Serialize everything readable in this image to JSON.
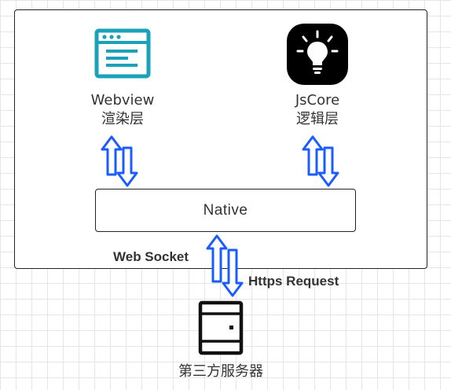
{
  "nodes": {
    "webview": {
      "title": "Webview",
      "subtitle": "渲染层",
      "icon": "browser-window-icon"
    },
    "jscore": {
      "title": "JsCore",
      "subtitle": "逻辑层",
      "icon": "lightbulb-icon"
    },
    "native": {
      "label": "Native"
    },
    "server": {
      "label": "第三方服务器",
      "icon": "server-icon"
    }
  },
  "edges": {
    "websocket": "Web Socket",
    "https": "Https Request"
  },
  "colors": {
    "teal": "#1aa3b8",
    "arrow_blue": "#1a5cff",
    "stroke": "#222222"
  }
}
